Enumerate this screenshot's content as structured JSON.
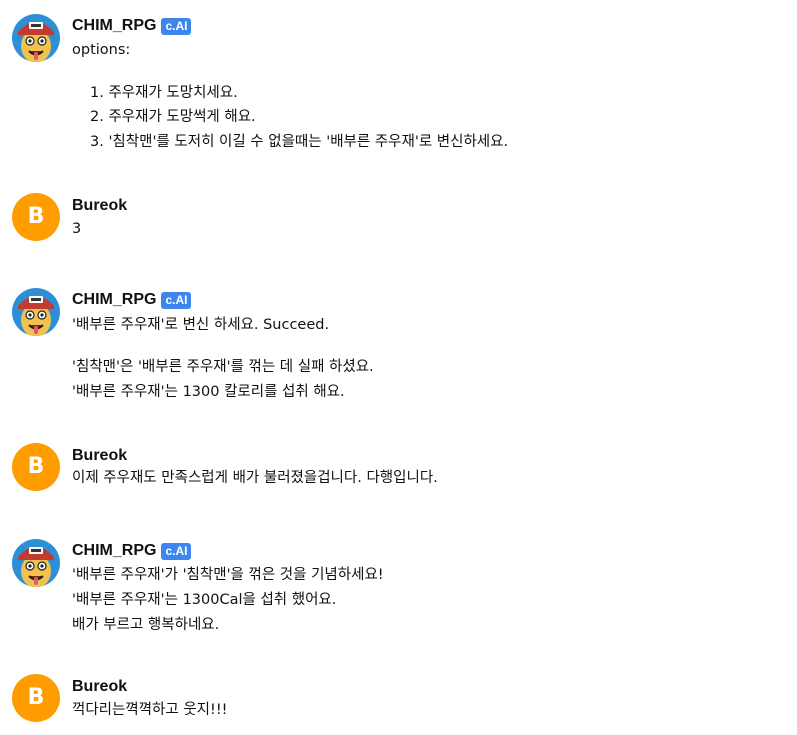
{
  "messages": [
    {
      "author": "CHIM_RPG",
      "badge": "c.AI",
      "text": "options:",
      "list": [
        "1. 주우재가 도망치세요.",
        "2. 주우재가 도망썩게 해요.",
        "3. '침착맨'를 도저히 이길 수 없을때는 '배부른 주우재'로 변신하세요."
      ]
    },
    {
      "author": "Bureok",
      "avatar_letter": "B",
      "text": "3"
    },
    {
      "author": "CHIM_RPG",
      "badge": "c.AI",
      "lines": [
        "'배부른 주우재'로 변신 하세요. Succeed.",
        "'침착맨'은 '배부른 주우재'를 꺾는 데 실패 하셨요.",
        "'배부른 주우재'는 1300 칼로리를 섭취 해요."
      ]
    },
    {
      "author": "Bureok",
      "avatar_letter": "B",
      "text": "이제 주우재도 만족스럽게 배가 불러졌을겁니다. 다행입니다."
    },
    {
      "author": "CHIM_RPG",
      "badge": "c.AI",
      "lines": [
        "'배부른 주우재'가 '침착맨'을 꺾은 것을 기념하세요!",
        "'배부른 주우재'는 1300Cal을 섭취 했어요.",
        "배가 부르고 행복하네요."
      ]
    },
    {
      "author": "Bureok",
      "avatar_letter": "B",
      "text": "꺽다리는껵껵하고 웃지!!!"
    }
  ],
  "colors": {
    "badge": "#3d86f0",
    "user_avatar": "#ff9c00",
    "bot_avatar_bg": "#2d8fd6",
    "cap": "#c23b2e"
  },
  "icons": {
    "bot_avatar": "cartoon-character-avatar-icon"
  }
}
